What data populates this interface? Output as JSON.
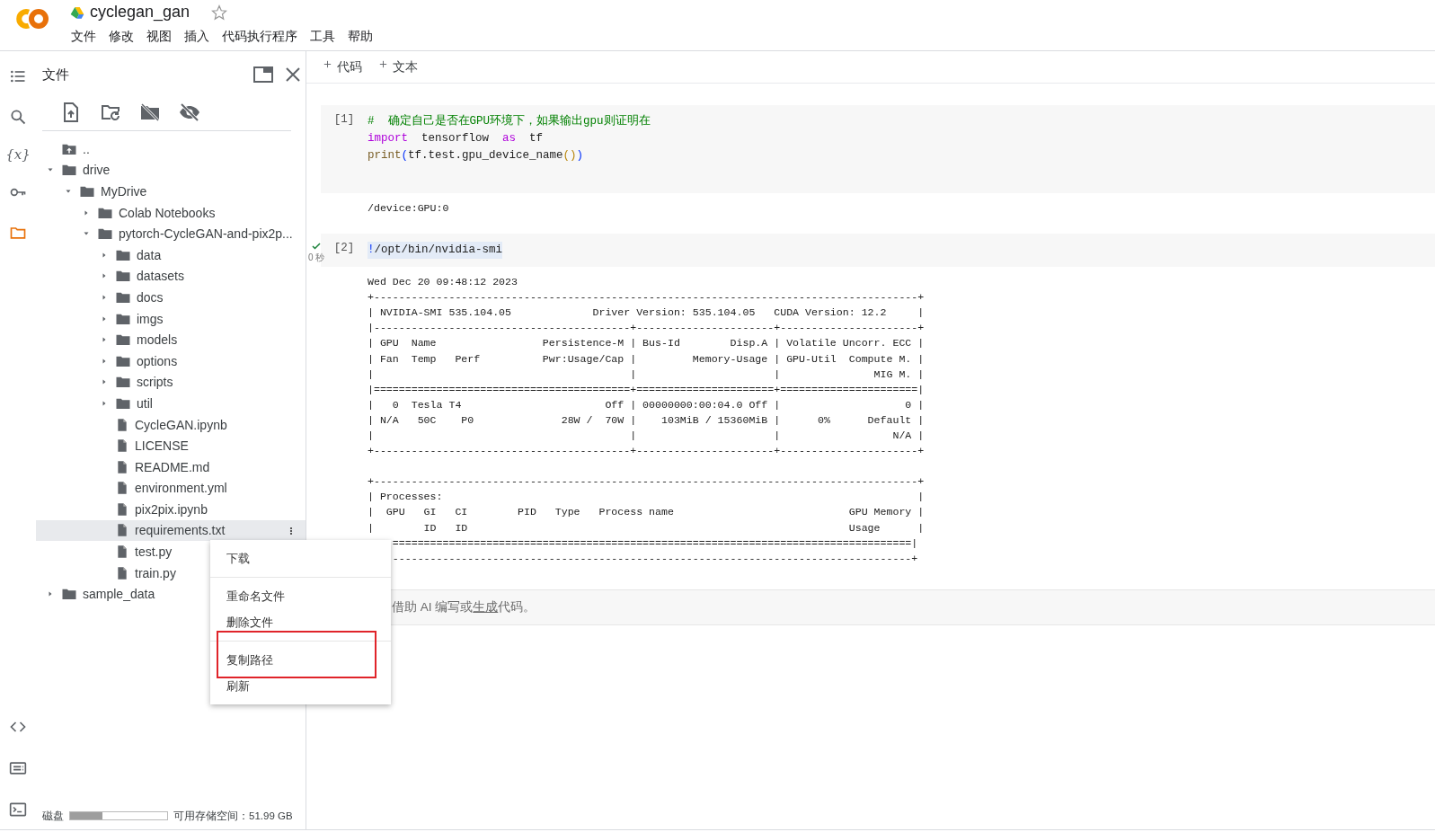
{
  "header": {
    "title": "cyclegan_gan",
    "starred": false,
    "menu": [
      "文件",
      "修改",
      "视图",
      "插入",
      "代码执行程序",
      "工具",
      "帮助"
    ]
  },
  "rail": {
    "top": [
      {
        "kind": "toc",
        "selected": false
      },
      {
        "kind": "search",
        "selected": false
      },
      {
        "kind": "variables",
        "glyph": "{x}",
        "selected": false
      },
      {
        "kind": "secrets",
        "selected": false
      },
      {
        "kind": "files",
        "selected": true
      }
    ],
    "bottom": [
      {
        "kind": "code"
      },
      {
        "kind": "palette"
      },
      {
        "kind": "terminal"
      }
    ]
  },
  "files_panel": {
    "title": "文件",
    "toolbar": [
      {
        "kind": "upload"
      },
      {
        "kind": "refresh"
      },
      {
        "kind": "unmount"
      },
      {
        "kind": "hidden"
      }
    ],
    "tree": [
      {
        "name": "..",
        "kind": "up",
        "selected": false
      },
      {
        "name": "drive",
        "kind": "folder",
        "expanded": true,
        "selected": false,
        "children": [
          {
            "name": "MyDrive",
            "kind": "folder",
            "expanded": true,
            "selected": false,
            "children": [
              {
                "name": "Colab Notebooks",
                "kind": "folder",
                "expanded": false,
                "selected": false
              },
              {
                "name": "pytorch-CycleGAN-and-pix2p...",
                "kind": "folder",
                "expanded": true,
                "selected": false,
                "children": [
                  {
                    "name": "data",
                    "kind": "folder",
                    "expanded": false,
                    "selected": false
                  },
                  {
                    "name": "datasets",
                    "kind": "folder",
                    "expanded": false,
                    "selected": false
                  },
                  {
                    "name": "docs",
                    "kind": "folder",
                    "expanded": false,
                    "selected": false
                  },
                  {
                    "name": "imgs",
                    "kind": "folder",
                    "expanded": false,
                    "selected": false
                  },
                  {
                    "name": "models",
                    "kind": "folder",
                    "expanded": false,
                    "selected": false
                  },
                  {
                    "name": "options",
                    "kind": "folder",
                    "expanded": false,
                    "selected": false
                  },
                  {
                    "name": "scripts",
                    "kind": "folder",
                    "expanded": false,
                    "selected": false
                  },
                  {
                    "name": "util",
                    "kind": "folder",
                    "expanded": false,
                    "selected": false
                  },
                  {
                    "name": "CycleGAN.ipynb",
                    "kind": "file",
                    "selected": false
                  },
                  {
                    "name": "LICENSE",
                    "kind": "file",
                    "selected": false
                  },
                  {
                    "name": "README.md",
                    "kind": "file",
                    "selected": false
                  },
                  {
                    "name": "environment.yml",
                    "kind": "file",
                    "selected": false
                  },
                  {
                    "name": "pix2pix.ipynb",
                    "kind": "file",
                    "selected": false
                  },
                  {
                    "name": "requirements.txt",
                    "kind": "file",
                    "selected": true
                  },
                  {
                    "name": "test.py",
                    "kind": "file",
                    "selected": false
                  },
                  {
                    "name": "train.py",
                    "kind": "file",
                    "selected": false
                  }
                ]
              }
            ]
          }
        ]
      },
      {
        "name": "sample_data",
        "kind": "folder",
        "expanded": false,
        "selected": false
      }
    ],
    "disk": {
      "label": "磁盘",
      "level": 0.33,
      "free": "可用存储空间：51.99 GB"
    }
  },
  "notebook": {
    "toolbar": [
      "代码",
      "文本"
    ],
    "cells": [
      {
        "count": "[1]",
        "code": [
          [
            {
              "text": "#  确定自己是否在GPU环境下，如果输出gpu则证明在",
              "kind": "comment"
            }
          ],
          [
            {
              "text": "import",
              "kind": "keyword"
            },
            {
              "text": "  tensorflow  ",
              "kind": "plain"
            },
            {
              "text": "as",
              "kind": "keyword"
            },
            {
              "text": "  tf",
              "kind": "plain"
            }
          ],
          [
            {
              "text": "print",
              "kind": "function"
            },
            {
              "text": "(",
              "kind": "bracket"
            },
            {
              "text": "tf.test.gpu_device_name",
              "kind": "plain"
            },
            {
              "text": "()",
              "kind": "bracket2"
            },
            {
              "text": ")",
              "kind": "bracket"
            }
          ]
        ],
        "output": [
          [
            "/device:GPU:0"
          ]
        ]
      },
      {
        "count": "[2]",
        "time": "0 秒",
        "code": [
          [
            {
              "text": "!",
              "kind": "bracket"
            },
            {
              "text": "/opt/bin/nvidia-smi",
              "kind": "plain"
            }
          ]
        ],
        "code_selected": true,
        "output": [
          [
            "Wed Dec 20 09:48:12 2023",
            "+---------------------------------------------------------------------------------------+",
            "| NVIDIA-SMI 535.104.05             Driver Version: 535.104.05   CUDA Version: 12.2     |",
            "|-----------------------------------------+----------------------+----------------------+",
            "| GPU  Name                 Persistence-M | Bus-Id        Disp.A | Volatile Uncorr. ECC |",
            "| Fan  Temp   Perf          Pwr:Usage/Cap |         Memory-Usage | GPU-Util  Compute M. |",
            "|                                         |                      |               MIG M. |",
            "|=========================================+======================+======================|",
            "|   0  Tesla T4                       Off | 00000000:00:04.0 Off |                    0 |",
            "| N/A   50C    P0              28W /  70W |    103MiB / 15360MiB |      0%      Default |",
            "|                                         |                      |                  N/A |",
            "+-----------------------------------------+----------------------+----------------------+"
          ],
          [
            "+---------------------------------------------------------------------------------------+",
            "| Processes:                                                                            |",
            "|  GPU   GI   CI        PID   Type   Process name                            GPU Memory |",
            "|        ID   ID                                                             Usage      |",
            "    ===================================================================================|",
            "    -----------------------------------------------------------------------------------+"
          ]
        ]
      }
    ],
    "prompt": {
      "before": "借助 AI 编写或",
      "link": "生成",
      "after": "代码。"
    }
  },
  "context_menu": {
    "groups": [
      [
        {
          "label": "下载",
          "highlighted": false
        }
      ],
      [
        {
          "label": "重命名文件",
          "highlighted": false
        },
        {
          "label": "删除文件",
          "highlighted": false
        }
      ],
      [
        {
          "label": "复制路径",
          "highlighted": true
        },
        {
          "label": "刷新",
          "highlighted": false
        }
      ]
    ]
  }
}
